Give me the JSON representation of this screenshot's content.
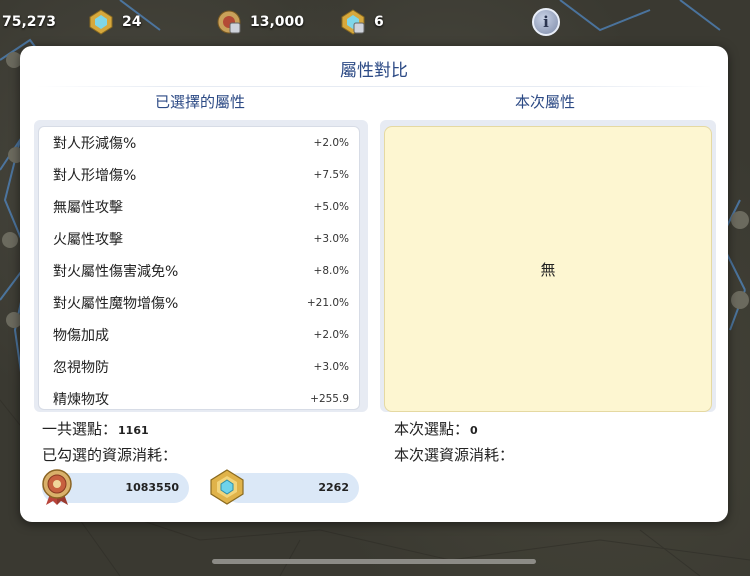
{
  "topbar": {
    "resource_1": "75,273",
    "resource_2": "24",
    "resource_3": "13,000",
    "resource_4": "6",
    "info_label": "i"
  },
  "modal": {
    "title": "屬性對比",
    "left_header": "已選擇的屬性",
    "right_header": "本次屬性",
    "attributes": [
      {
        "label": "對人形減傷%",
        "value": "+2.0%"
      },
      {
        "label": "對人形增傷%",
        "value": "+7.5%"
      },
      {
        "label": "無屬性攻擊",
        "value": "+5.0%"
      },
      {
        "label": "火屬性攻擊",
        "value": "+3.0%"
      },
      {
        "label": "對火屬性傷害減免%",
        "value": "+8.0%"
      },
      {
        "label": "對火屬性魔物增傷%",
        "value": "+21.0%"
      },
      {
        "label": "物傷加成",
        "value": "+2.0%"
      },
      {
        "label": "忽視物防",
        "value": "+3.0%"
      },
      {
        "label": "精煉物攻",
        "value": "+255.9"
      }
    ],
    "current_empty": "無",
    "total_points_label": "一共選點：",
    "total_points_value": "1161",
    "selected_cost_label": "已勾選的資源消耗：",
    "current_points_label": "本次選點：",
    "current_points_value": "0",
    "current_cost_label": "本次選資源消耗：",
    "cost_1": "1083550",
    "cost_2": "2262"
  },
  "icons": {
    "medal": "medal-icon",
    "crystal": "crystal-icon",
    "info": "info-icon"
  }
}
